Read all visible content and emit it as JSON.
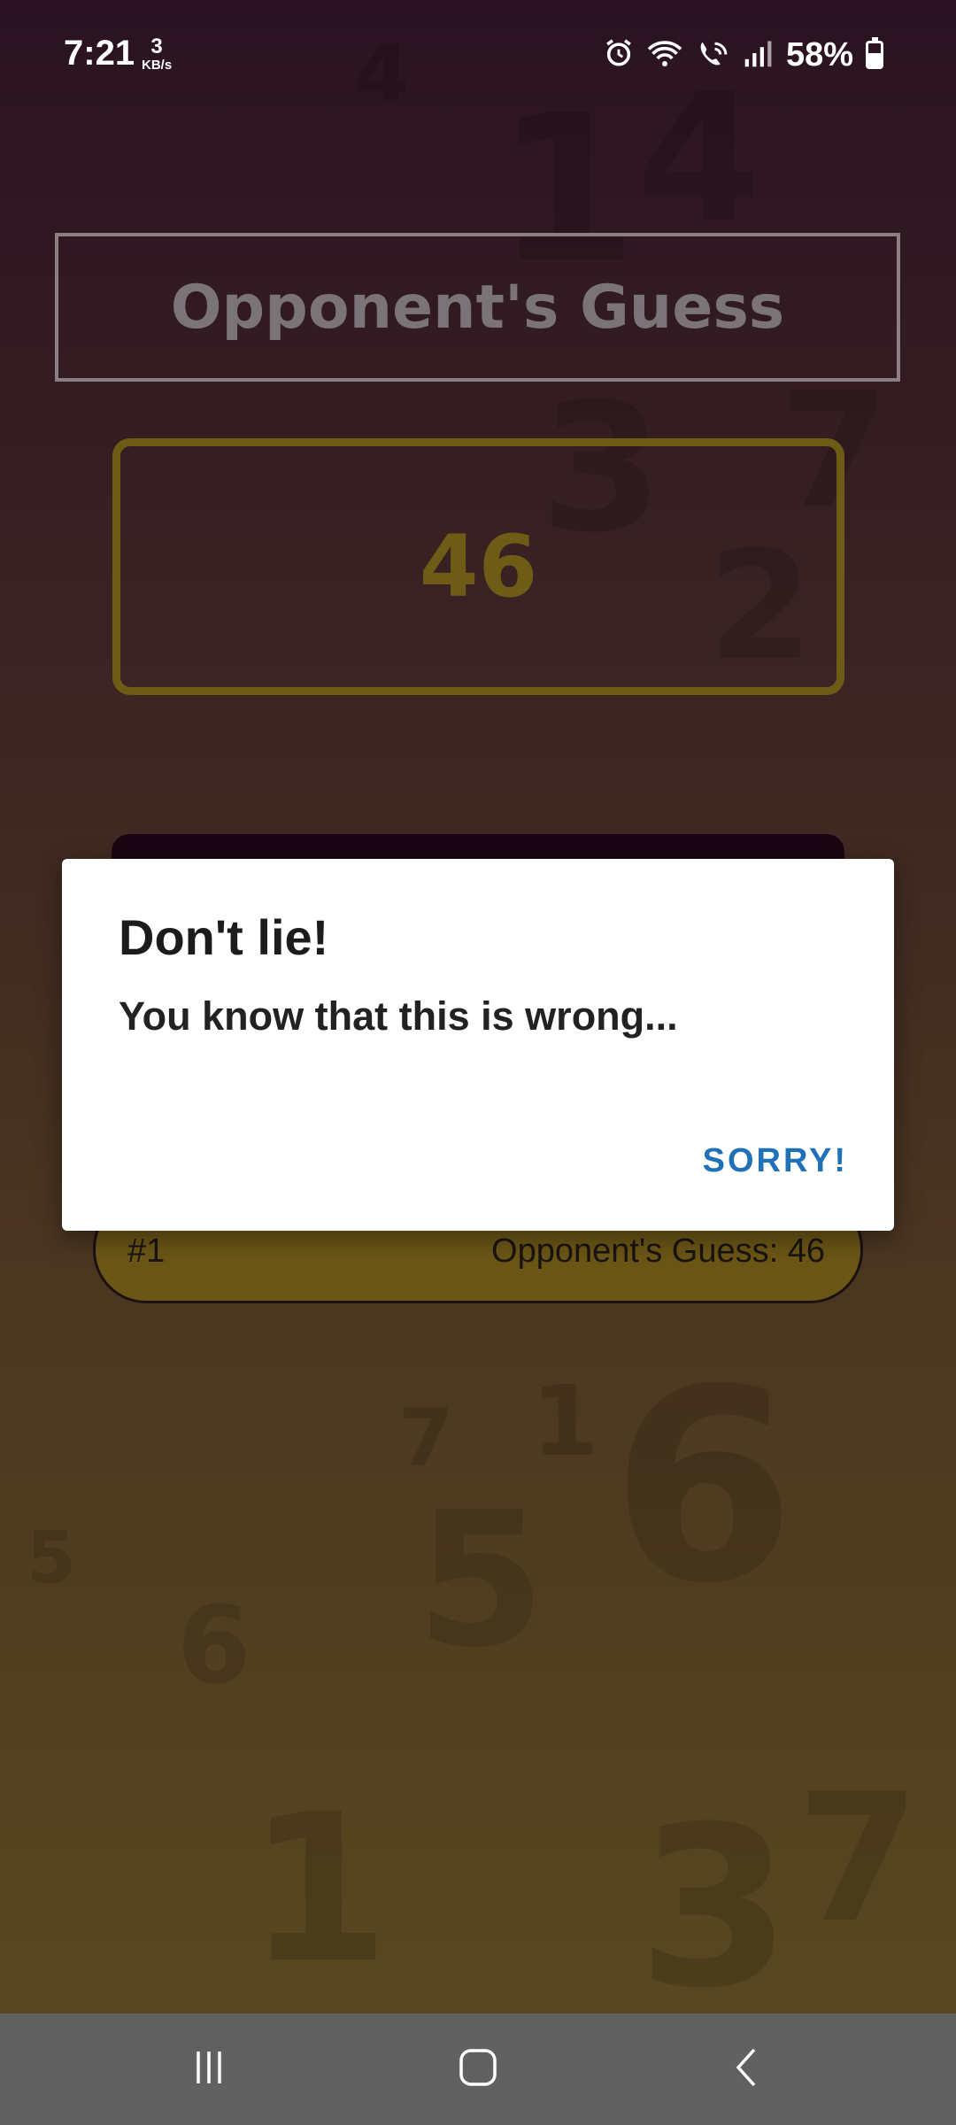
{
  "status_bar": {
    "time": "7:21",
    "speed_value": "3",
    "speed_unit": "KB/s",
    "battery": "58%"
  },
  "game": {
    "title": "Opponent's Guess",
    "current_guess": "46"
  },
  "log": {
    "entries": [
      {
        "index": "#1",
        "text": "Opponent's Guess: 46"
      }
    ]
  },
  "dialog": {
    "title": "Don't lie!",
    "message": "You know that this is wrong...",
    "button_label": "SORRY!"
  },
  "colors": {
    "accent": "#6e5c16",
    "dialog_button": "#1f72b8",
    "nav_bar": "#616161"
  },
  "icons": {
    "alarm": "alarm-icon",
    "wifi": "wifi-icon",
    "wifi_call": "wifi-call-icon",
    "signal": "signal-icon",
    "battery": "battery-icon",
    "recents": "recents-icon",
    "home": "home-icon",
    "back": "back-icon"
  }
}
